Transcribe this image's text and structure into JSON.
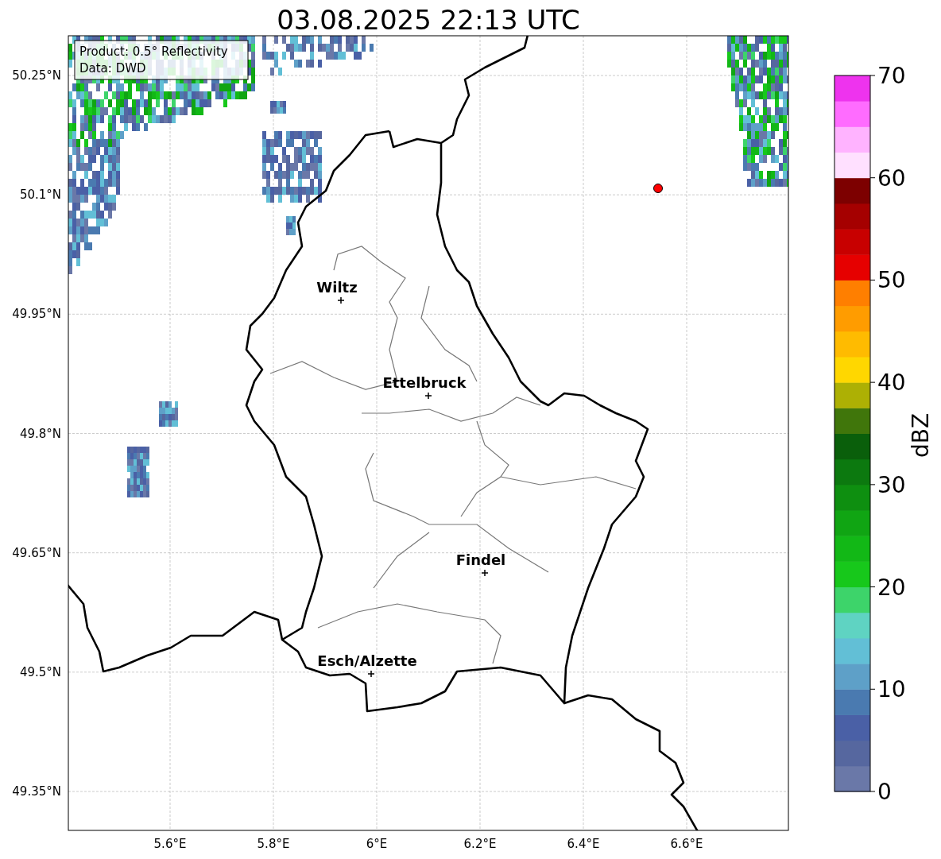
{
  "title": "03.08.2025 22:13 UTC",
  "info_box": {
    "lines": [
      "Product: 0.5° Reflectivity",
      "Data: DWD"
    ]
  },
  "lat_ticks": [
    "50.25°N",
    "50.1°N",
    "49.95°N",
    "49.8°N",
    "49.65°N",
    "49.5°N",
    "49.35°N"
  ],
  "lon_ticks": [
    "5.6°E",
    "5.8°E",
    "6°E",
    "6.2°E",
    "6.4°E",
    "6.6°E"
  ],
  "cities": [
    {
      "name": "Wiltz"
    },
    {
      "name": "Ettelbruck"
    },
    {
      "name": "Findel"
    },
    {
      "name": "Esch/Alzette"
    }
  ],
  "colorbar": {
    "label": "dBZ",
    "ticks": [
      "70",
      "60",
      "50",
      "40",
      "30",
      "20",
      "10",
      "0"
    ],
    "bins": [
      {
        "color": "#6a78a8"
      },
      {
        "color": "#56679f"
      },
      {
        "color": "#4a60a6"
      },
      {
        "color": "#4a7ab0"
      },
      {
        "color": "#5ea0c8"
      },
      {
        "color": "#62bfd6"
      },
      {
        "color": "#5fd3c2"
      },
      {
        "color": "#3dd46a"
      },
      {
        "color": "#17c81b"
      },
      {
        "color": "#12b816"
      },
      {
        "color": "#10a513"
      },
      {
        "color": "#0e8f10"
      },
      {
        "color": "#0c790f"
      },
      {
        "color": "#0a5f0b"
      },
      {
        "color": "#40760b"
      },
      {
        "color": "#adb004"
      },
      {
        "color": "#ffd700"
      },
      {
        "color": "#ffbb00"
      },
      {
        "color": "#ff9c00"
      },
      {
        "color": "#ff7f00"
      },
      {
        "color": "#e60000"
      },
      {
        "color": "#c80000"
      },
      {
        "color": "#a50000"
      },
      {
        "color": "#7d0000"
      },
      {
        "color": "#ffe0ff"
      },
      {
        "color": "#ffb3ff"
      },
      {
        "color": "#ff6cff"
      },
      {
        "color": "#ee33ee"
      }
    ]
  }
}
